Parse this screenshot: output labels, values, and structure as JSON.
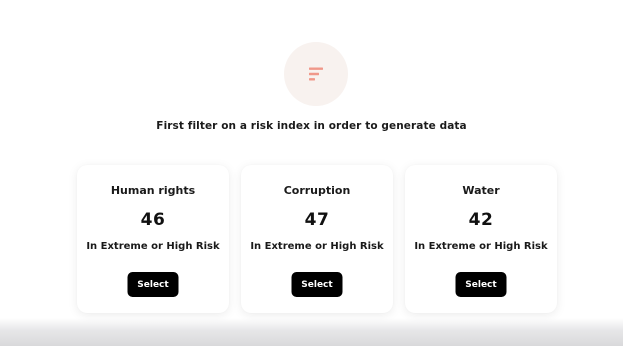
{
  "empty_state": {
    "icon": "filter-bars-icon",
    "icon_color": "#f0988a",
    "message": "First filter on a risk index in order to generate data"
  },
  "cards": [
    {
      "title": "Human rights",
      "count": "46",
      "caption": "In Extreme or High Risk",
      "button_label": "Select"
    },
    {
      "title": "Corruption",
      "count": "47",
      "caption": "In Extreme or High Risk",
      "button_label": "Select"
    },
    {
      "title": "Water",
      "count": "42",
      "caption": "In Extreme or High Risk",
      "button_label": "Select"
    }
  ]
}
